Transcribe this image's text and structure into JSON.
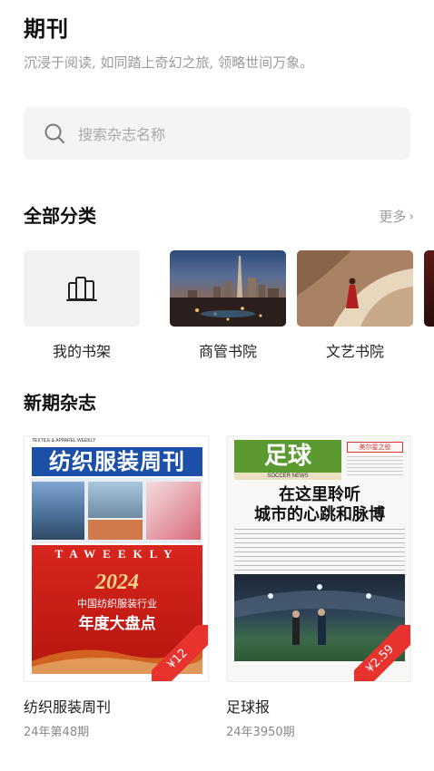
{
  "header": {
    "title": "期刊",
    "subtitle": "沉浸于阅读, 如同踏上奇幻之旅, 领略世间万象。"
  },
  "search": {
    "placeholder": "搜索杂志名称",
    "icon": "search-icon"
  },
  "categories_section": {
    "title": "全部分类",
    "more_label": "更多",
    "items": [
      {
        "label": "我的书架",
        "icon": "bookshelf-icon"
      },
      {
        "label": "商管书院"
      },
      {
        "label": "文艺书院"
      }
    ]
  },
  "new_issues": {
    "title": "新期杂志",
    "items": [
      {
        "name": "纺织服装周刊",
        "issue": "24年第48期",
        "price": "¥12",
        "cover_masthead": "纺织服装周刊",
        "cover_en": "TEXTILE & APPAREL WEEKLY",
        "cover_band": "TAWEEKLY",
        "cover_year": "2024",
        "cover_line1": "中国纺织服装行业",
        "cover_line2": "年度大盘点"
      },
      {
        "name": "足球报",
        "issue": "24年3950期",
        "price": "¥2.59",
        "cover_masthead": "足球",
        "cover_en": "SOCCER NEWS",
        "cover_headline1": "在这里聆听",
        "cover_headline2": "城市的心跳和脉博",
        "cover_tag": "美尔星之役"
      }
    ]
  },
  "colors": {
    "accent_red": "#e8322d",
    "textile_blue": "#1b4fa8",
    "soccer_green": "#4a8a2a"
  }
}
